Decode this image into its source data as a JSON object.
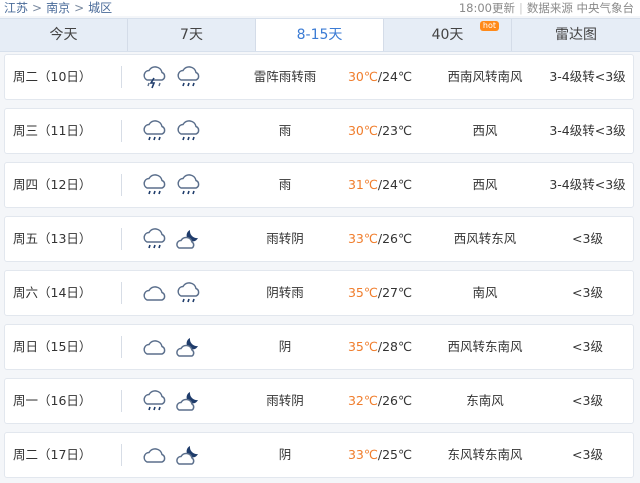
{
  "breadcrumb": [
    "江苏",
    "南京",
    "城区"
  ],
  "update_time": "18:00更新",
  "source": "数据来源 中央气象台",
  "tabs": [
    {
      "label": "今天"
    },
    {
      "label": "7天"
    },
    {
      "label": "8-15天",
      "active": true
    },
    {
      "label": "40天",
      "badge": "hot"
    },
    {
      "label": "雷达图"
    }
  ],
  "colors": {
    "accent": "#3b7bd4",
    "high_temp": "#f07d2c",
    "hot_badge": "#ff8a1a"
  },
  "forecast": [
    {
      "day": "周二（10日）",
      "icon1": "thunder-rain-icon",
      "icon2": "rain-icon",
      "cond": "雷阵雨转雨",
      "high": "30℃",
      "low": "/24℃",
      "wind": "西南风转南风",
      "level": "3-4级转<3级"
    },
    {
      "day": "周三（11日）",
      "icon1": "rain-icon",
      "icon2": "rain-icon",
      "cond": "雨",
      "high": "30℃",
      "low": "/23℃",
      "wind": "西风",
      "level": "3-4级转<3级"
    },
    {
      "day": "周四（12日）",
      "icon1": "rain-icon",
      "icon2": "rain-icon",
      "cond": "雨",
      "high": "31℃",
      "low": "/24℃",
      "wind": "西风",
      "level": "3-4级转<3级"
    },
    {
      "day": "周五（13日）",
      "icon1": "rain-icon",
      "icon2": "overcast-night-icon",
      "cond": "雨转阴",
      "high": "33℃",
      "low": "/26℃",
      "wind": "西风转东风",
      "level": "<3级"
    },
    {
      "day": "周六（14日）",
      "icon1": "cloud-icon",
      "icon2": "rain-icon",
      "cond": "阴转雨",
      "high": "35℃",
      "low": "/27℃",
      "wind": "南风",
      "level": "<3级"
    },
    {
      "day": "周日（15日）",
      "icon1": "cloud-icon",
      "icon2": "overcast-night-icon",
      "cond": "阴",
      "high": "35℃",
      "low": "/28℃",
      "wind": "西风转东南风",
      "level": "<3级"
    },
    {
      "day": "周一（16日）",
      "icon1": "rain-icon",
      "icon2": "overcast-night-icon",
      "cond": "雨转阴",
      "high": "32℃",
      "low": "/26℃",
      "wind": "东南风",
      "level": "<3级"
    },
    {
      "day": "周二（17日）",
      "icon1": "cloud-icon",
      "icon2": "overcast-night-icon",
      "cond": "阴",
      "high": "33℃",
      "low": "/25℃",
      "wind": "东风转东南风",
      "level": "<3级"
    }
  ]
}
